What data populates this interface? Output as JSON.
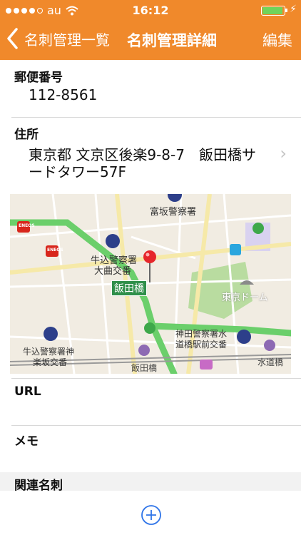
{
  "status": {
    "carrier": "au",
    "time": "16:12",
    "signal_bars": 4,
    "battery_level": 0.9
  },
  "nav": {
    "back_label": "名刺管理一覧",
    "title": "名刺管理詳細",
    "edit_label": "編集"
  },
  "postal": {
    "label": "郵便番号",
    "value": "112-8561"
  },
  "address": {
    "label": "住所",
    "line1": "東京都 文京区後楽9-8-7　飯田橋サ",
    "line2": "ードタワー57F"
  },
  "map": {
    "labels": {
      "police_tomisaka": "富坂警察署",
      "police_ushigome1": "牛込警察署",
      "police_ushigome2": "大曲交番",
      "station": "飯田橋",
      "tokyo_dome": "東京ドーム",
      "police_kanda1": "神田警察署水",
      "police_kanda2": "道橋駅前交番",
      "police_ushigome3": "牛込警察署神",
      "police_ushigome4": "楽坂交番",
      "iidabashi": "飯田橋",
      "suidobashi": "水道橋",
      "eneos": "ENEOS"
    },
    "colors": {
      "road_green": "#6bcf6b",
      "road_yellow": "#f6e9a8",
      "base": "#f1ece2",
      "park": "#b9dca0",
      "pin": "#e6262a"
    }
  },
  "url": {
    "label": "URL"
  },
  "memo": {
    "label": "メモ"
  },
  "related": {
    "label": "関連名刺"
  },
  "theme": {
    "accent": "#f0892b",
    "add_button": "#2e74e8"
  }
}
